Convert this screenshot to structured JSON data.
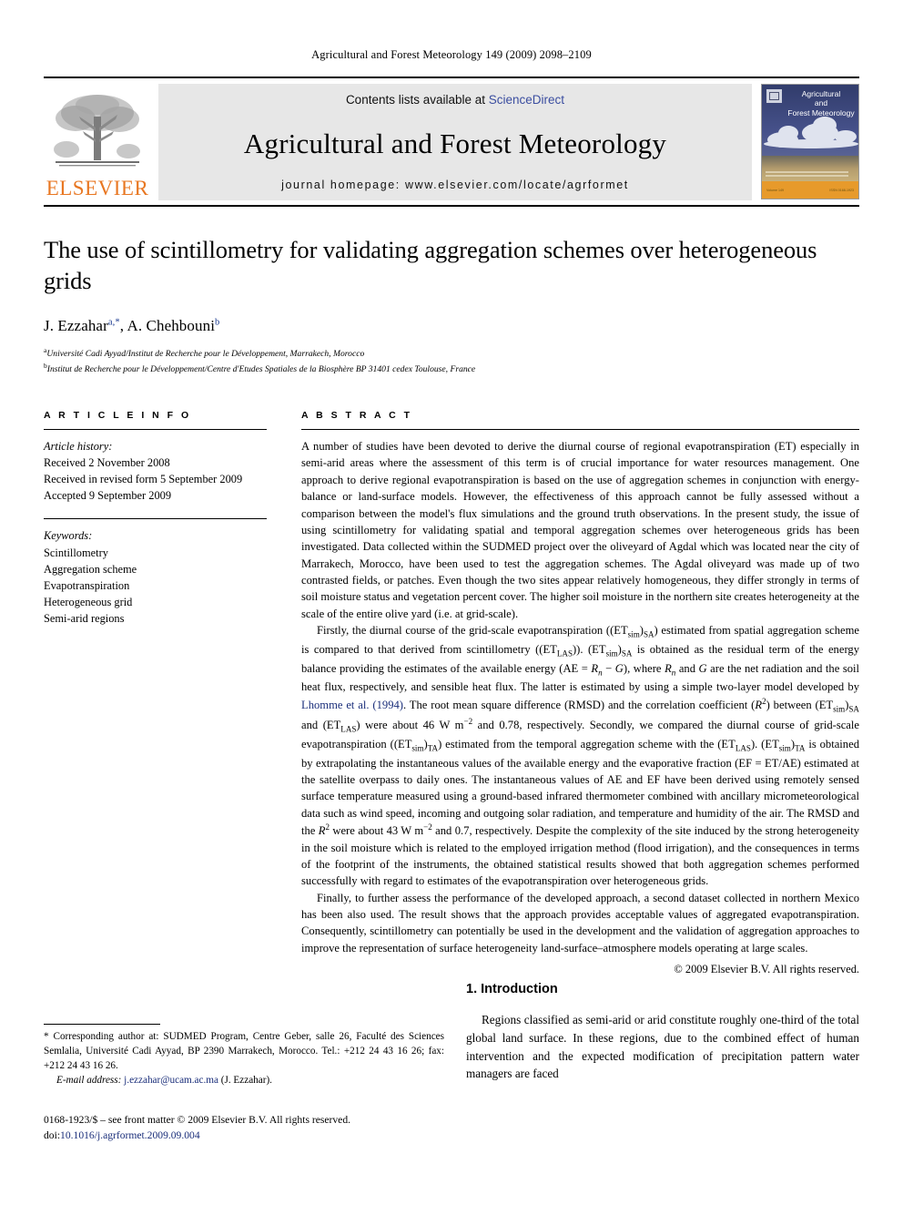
{
  "running_head": "Agricultural and Forest Meteorology 149 (2009) 2098–2109",
  "masthead": {
    "publisher_name": "ELSEVIER",
    "contents_prefix": "Contents lists available at ",
    "sciencedirect_label": "ScienceDirect",
    "journal_title": "Agricultural and Forest Meteorology",
    "homepage_line": "journal homepage: www.elsevier.com/locate/agrformet",
    "cover": {
      "title_line1": "Agricultural",
      "title_line2": "and",
      "title_line3": "Forest Meteorology",
      "small_left": "Volume 149",
      "small_right": "ISSN 0168-1923"
    },
    "link_color": "#3b4ea0",
    "brand_color": "#E87722"
  },
  "article": {
    "title": "The use of scintillometry for validating aggregation schemes over heterogeneous grids",
    "authors_part1": "J. Ezzahar",
    "authors_sup1": "a,*",
    "authors_part2": ", A. Chehbouni",
    "authors_sup2": "b",
    "affiliation_a_marker": "a",
    "affiliation_a": "Université Cadi Ayyad/Institut de Recherche pour le Développement, Marrakech, Morocco",
    "affiliation_b_marker": "b",
    "affiliation_b": "Institut de Recherche pour le Développement/Centre d'Etudes Spatiales de la Biosphère BP 31401 cedex Toulouse, France"
  },
  "article_info": {
    "heading": "A R T I C L E    I N F O",
    "history_label": "Article history:",
    "history": [
      "Received 2 November 2008",
      "Received in revised form 5 September 2009",
      "Accepted 9 September 2009"
    ],
    "keywords_label": "Keywords:",
    "keywords": [
      "Scintillometry",
      "Aggregation scheme",
      "Evapotranspiration",
      "Heterogeneous grid",
      "Semi-arid regions"
    ]
  },
  "abstract": {
    "heading": "A B S T R A C T",
    "para1": "A number of studies have been devoted to derive the diurnal course of regional evapotranspiration (ET) especially in semi-arid areas where the assessment of this term is of crucial importance for water resources management. One approach to derive regional evapotranspiration is based on the use of aggregation schemes in conjunction with energy-balance or land-surface models. However, the effectiveness of this approach cannot be fully assessed without a comparison between the model's flux simulations and the ground truth observations. In the present study, the issue of using scintillometry for validating spatial and temporal aggregation schemes over heterogeneous grids has been investigated. Data collected within the SUDMED project over the oliveyard of Agdal which was located near the city of Marrakech, Morocco, have been used to test the aggregation schemes. The Agdal oliveyard was made up of two contrasted fields, or patches. Even though the two sites appear relatively homogeneous, they differ strongly in terms of soil moisture status and vegetation percent cover. The higher soil moisture in the northern site creates heterogeneity at the scale of the entire olive yard (i.e. at grid-scale).",
    "para2_seg1": "Firstly, the diurnal course of the grid-scale evapotranspiration ((ET",
    "para2_sub1": "sim",
    "para2_seg2": ")",
    "para2_sub2": "SA",
    "para2_seg3": ") estimated from spatial aggregation scheme is compared to that derived from scintillometry ((ET",
    "para2_sub3": "LAS",
    "para2_seg4": ")). (ET",
    "para2_sub4": "sim",
    "para2_seg5": ")",
    "para2_sub5": "SA",
    "para2_seg6": " is obtained as the residual term of the energy balance providing the estimates of the available energy (AE = ",
    "para2_rn1": "R",
    "para2_rn1sub": "n",
    "para2_seg7": " − ",
    "para2_g1": "G",
    "para2_seg8": "), where ",
    "para2_rn2": "R",
    "para2_rn2sub": "n",
    "para2_seg9": " and ",
    "para2_g2": "G",
    "para2_seg10": " are the net radiation and the soil heat flux, respectively, and sensible heat flux. The latter is estimated by using a simple two-layer model developed by ",
    "para2_citation": "Lhomme et al. (1994)",
    "para2_seg11": ". The root mean square difference (RMSD) and the correlation coefficient (",
    "para2_r1": "R",
    "para2_r1sup": "2",
    "para2_seg12": ") between (ET",
    "para2_sub6": "sim",
    "para2_seg13": ")",
    "para2_sub7": "SA",
    "para2_seg14": " and (ET",
    "para2_sub8": "LAS",
    "para2_seg15": ") were about 46 W m",
    "para2_sup1": "−2",
    "para2_seg16": " and 0.78, respectively. Secondly, we compared the diurnal course of grid-scale evapotranspiration ((ET",
    "para2_sub9": "sim",
    "para2_seg17": ")",
    "para2_sub10": "TA",
    "para2_seg18": ") estimated from the temporal aggregation scheme with the (ET",
    "para2_sub11": "LAS",
    "para2_seg19": "). (ET",
    "para2_sub12": "sim",
    "para2_seg20": ")",
    "para2_sub13": "TA",
    "para2_seg21": " is obtained by extrapolating the instantaneous values of the available energy and the evaporative fraction (EF = ET/AE) estimated at the satellite overpass to daily ones. The instantaneous values of AE and EF have been derived using remotely sensed surface temperature measured using a ground-based infrared thermometer combined with ancillary micrometeorological data such as wind speed, incoming and outgoing solar radiation, and temperature and humidity of the air. The RMSD and the ",
    "para2_r2": "R",
    "para2_r2sup": "2",
    "para2_seg22": " were about 43 W m",
    "para2_sup2": "−2",
    "para2_seg23": " and 0.7, respectively. Despite the complexity of the site induced by the strong heterogeneity in the soil moisture which is related to the employed irrigation method (flood irrigation), and the consequences in terms of the footprint of the instruments, the obtained statistical results showed that both aggregation schemes performed successfully with regard to estimates of the evapotranspiration over heterogeneous grids.",
    "para3": "Finally, to further assess the performance of the developed approach, a second dataset collected in northern Mexico has been also used. The result shows that the approach provides acceptable values of aggregated evapotranspiration. Consequently, scintillometry can potentially be used in the development and the validation of aggregation approaches to improve the representation of surface heterogeneity land-surface–atmosphere models operating at large scales.",
    "copyright": "© 2009 Elsevier B.V. All rights reserved."
  },
  "footnote": {
    "star": "*",
    "corresponding": " Corresponding author at: SUDMED Program, Centre Geber, salle 26, Faculté des Sciences Semlalia, Université Cadi Ayyad, BP 2390 Marrakech, Morocco. Tel.: +212 24 43 16 26; fax: +212 24 43 16 26.",
    "email_label": "E-mail address:",
    "email": "j.ezzahar@ucam.ac.ma",
    "email_suffix": " (J. Ezzahar).",
    "issn_line": "0168-1923/$ – see front matter © 2009 Elsevier B.V. All rights reserved.",
    "doi_label": "doi:",
    "doi_value": "10.1016/j.agrformet.2009.09.004"
  },
  "introduction": {
    "heading": "1. Introduction",
    "para1": "Regions classified as semi-arid or arid constitute roughly one-third of the total global land surface. In these regions, due to the combined effect of human intervention and the expected modification of precipitation pattern water managers are faced"
  }
}
